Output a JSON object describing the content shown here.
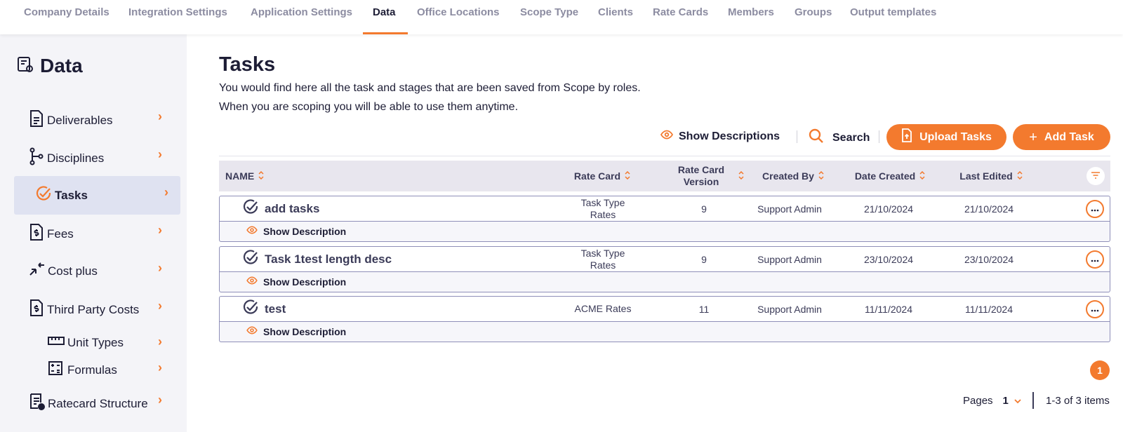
{
  "topnav": {
    "tabs": [
      {
        "label": "Company Details"
      },
      {
        "label": "Integration Settings"
      },
      {
        "label": "Application Settings"
      },
      {
        "label": "Data"
      },
      {
        "label": "Office Locations"
      },
      {
        "label": "Scope Type"
      },
      {
        "label": "Clients"
      },
      {
        "label": "Rate Cards"
      },
      {
        "label": "Members"
      },
      {
        "label": "Groups"
      },
      {
        "label": "Output templates"
      }
    ],
    "active": "Data",
    "accent": "#f37a2e"
  },
  "sidebar": {
    "title": "Data",
    "items": [
      {
        "label": "Deliverables",
        "icon": "document-icon"
      },
      {
        "label": "Disciplines",
        "icon": "hierarchy-icon"
      },
      {
        "label": "Tasks",
        "icon": "check-circle-icon",
        "active": true
      },
      {
        "label": "Fees",
        "icon": "dollar-document-icon"
      },
      {
        "label": "Cost plus",
        "icon": "arrows-in-icon"
      },
      {
        "label": "Third Party Costs",
        "icon": "dollar-document-icon"
      },
      {
        "label": "Unit Types",
        "icon": "ruler-icon"
      },
      {
        "label": "Formulas",
        "icon": "calculator-icon"
      },
      {
        "label": "Ratecard Structure",
        "icon": "ratecard-icon"
      }
    ]
  },
  "main": {
    "title": "Tasks",
    "desc_line1": "You would find here all the task and stages that are been saved from Scope by roles.",
    "desc_line2": "When you are scoping you will be able to use them anytime."
  },
  "toolbar": {
    "show_descriptions": "Show Descriptions",
    "search": "Search",
    "upload": "Upload Tasks",
    "add": "Add Task"
  },
  "table": {
    "headers": {
      "name": "NAME",
      "rate_card": "Rate Card",
      "rate_card_version_1": "Rate Card",
      "rate_card_version_2": "Version",
      "created_by": "Created By",
      "date_created": "Date Created",
      "last_edited": "Last Edited"
    },
    "show_description": "Show Description",
    "rows": [
      {
        "name": "add tasks",
        "rate_card_1": "Task Type",
        "rate_card_2": "Rates",
        "version": "9",
        "created_by": "Support Admin",
        "date_created": "21/10/2024",
        "last_edited": "21/10/2024"
      },
      {
        "name": "Task 1test length desc",
        "rate_card_1": "Task Type",
        "rate_card_2": "Rates",
        "version": "9",
        "created_by": "Support Admin",
        "date_created": "23/10/2024",
        "last_edited": "23/10/2024"
      },
      {
        "name": "test",
        "rate_card_1": "ACME Rates",
        "rate_card_2": "",
        "version": "11",
        "created_by": "Support Admin",
        "date_created": "11/11/2024",
        "last_edited": "11/11/2024"
      }
    ]
  },
  "pagination": {
    "badge": "1",
    "pages_label": "Pages",
    "current_page": "1",
    "summary": "1-3 of 3 items"
  }
}
